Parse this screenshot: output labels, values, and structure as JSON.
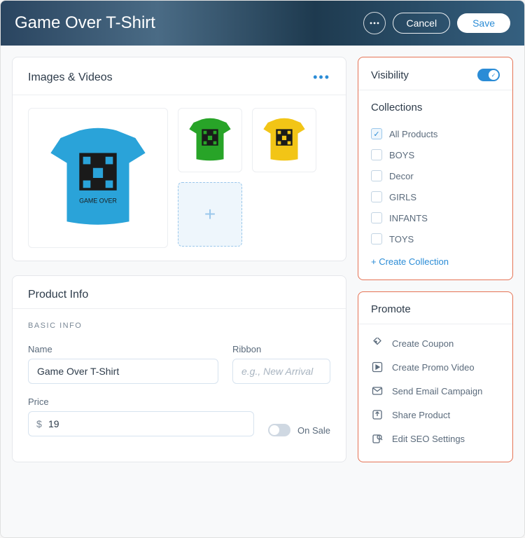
{
  "header": {
    "title": "Game Over T-Shirt",
    "cancel": "Cancel",
    "save": "Save"
  },
  "images": {
    "title": "Images & Videos",
    "main_color": "#2aa3d9",
    "thumbs": [
      {
        "color": "#28a428"
      },
      {
        "color": "#f2c516"
      }
    ],
    "caption": "GAME OVER"
  },
  "productInfo": {
    "title": "Product Info",
    "sectionLabel": "BASIC INFO",
    "nameLabel": "Name",
    "nameValue": "Game Over T-Shirt",
    "ribbonLabel": "Ribbon",
    "ribbonPlaceholder": "e.g., New Arrival",
    "priceLabel": "Price",
    "currency": "$",
    "priceValue": "19",
    "onSaleLabel": "On Sale"
  },
  "visibility": {
    "title": "Visibility",
    "on": true,
    "collectionsTitle": "Collections",
    "items": [
      {
        "label": "All Products",
        "checked": true
      },
      {
        "label": "BOYS",
        "checked": false
      },
      {
        "label": "Decor",
        "checked": false
      },
      {
        "label": "GIRLS",
        "checked": false
      },
      {
        "label": "INFANTS",
        "checked": false
      },
      {
        "label": "TOYS",
        "checked": false
      }
    ],
    "createLabel": "+ Create Collection"
  },
  "promote": {
    "title": "Promote",
    "items": [
      {
        "label": "Create Coupon",
        "icon": "tag"
      },
      {
        "label": "Create Promo Video",
        "icon": "play"
      },
      {
        "label": "Send Email Campaign",
        "icon": "mail"
      },
      {
        "label": "Share Product",
        "icon": "share"
      },
      {
        "label": "Edit SEO Settings",
        "icon": "seo"
      }
    ]
  }
}
